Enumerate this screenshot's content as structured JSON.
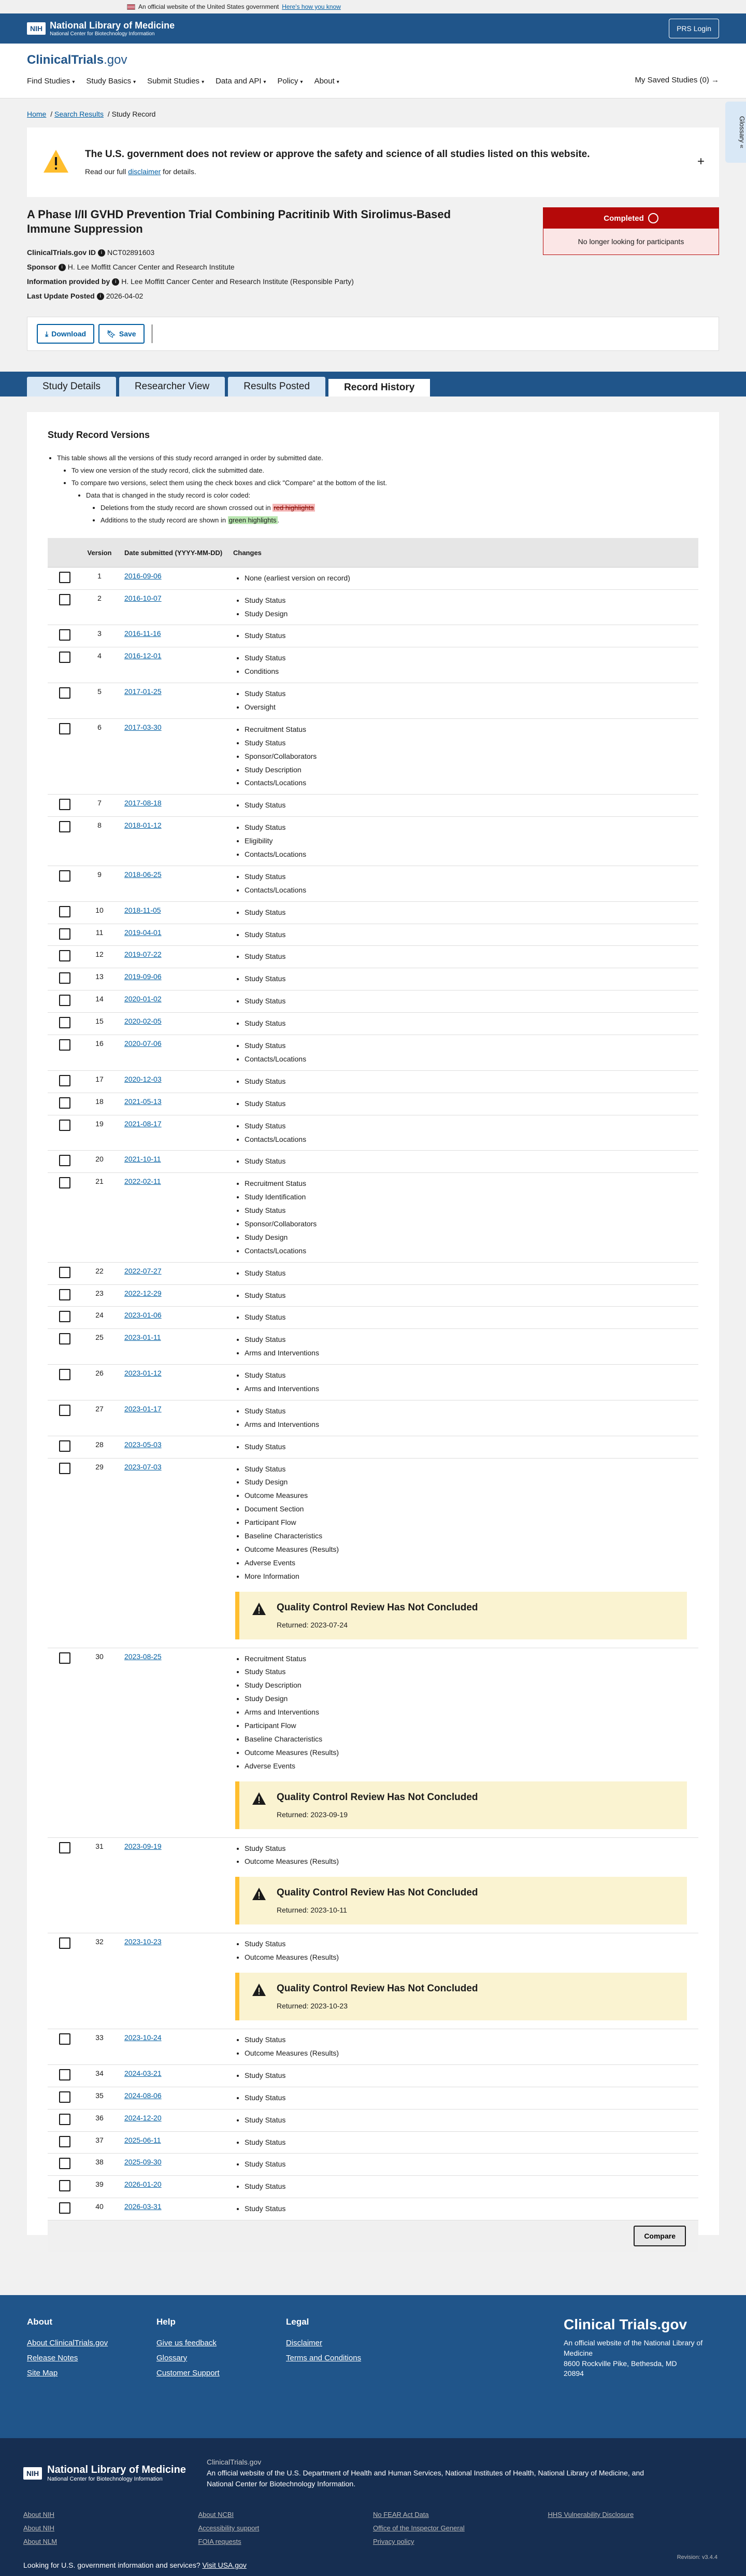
{
  "gov_banner": {
    "text": "An official website of the United States government",
    "link": "Here's how you know"
  },
  "nih": {
    "box": "NIH",
    "title": "National Library of Medicine",
    "subtitle": "National Center for Biotechnology Information",
    "prs": "PRS Login"
  },
  "site": {
    "brand_a": "ClinicalTrials",
    "brand_b": ".gov",
    "nav": [
      "Find Studies",
      "Study Basics",
      "Submit Studies",
      "Data and API",
      "Policy",
      "About"
    ],
    "saved": "My Saved Studies (0) →",
    "glossary": "Glossary"
  },
  "breadcrumb": [
    "Home",
    "Search Results",
    "Study Record"
  ],
  "warning": {
    "title": "The U.S. government does not review or approve the safety and science of all studies listed on this website.",
    "text_a": "Read our full ",
    "link": "disclaimer",
    "text_b": " for details."
  },
  "study": {
    "title": "A Phase I/II GVHD Prevention Trial Combining Pacritinib With Sirolimus-Based Immune Suppression",
    "id_label": "ClinicalTrials.gov ID",
    "id": "NCT02891603",
    "sponsor_label": "Sponsor",
    "sponsor": "H. Lee Moffitt Cancer Center and Research Institute",
    "info_label": "Information provided by",
    "info": "H. Lee Moffitt Cancer Center and Research Institute (Responsible Party)",
    "update_label": "Last Update Posted",
    "update": "2026-04-02",
    "status": "Completed",
    "status_note": "No longer looking for participants"
  },
  "actions": {
    "download": "Download",
    "save": "Save"
  },
  "tabs": [
    "Study Details",
    "Researcher View",
    "Results Posted",
    "Record History"
  ],
  "history": {
    "title": "Study Record Versions",
    "notes": [
      "This table shows all the versions of this study record arranged in order by submitted date.",
      "To view one version of the study record, click the submitted date.",
      "To compare two versions, select them using the check boxes and click \"Compare\" at the bottom of the list.",
      "Data that is changed in the study record is color coded:",
      "Deletions from the study record are shown crossed out in ",
      "red highlights",
      "Additions to the study record are shown in ",
      "green highlights",
      "."
    ],
    "headers": [
      "Version",
      "Date submitted (YYYY-MM-DD)",
      "Changes"
    ],
    "rows": [
      {
        "v": "1",
        "d": "2016-09-06",
        "c": [
          "None (earliest version on record)"
        ]
      },
      {
        "v": "2",
        "d": "2016-10-07",
        "c": [
          "Study Status",
          "Study Design"
        ]
      },
      {
        "v": "3",
        "d": "2016-11-16",
        "c": [
          "Study Status"
        ]
      },
      {
        "v": "4",
        "d": "2016-12-01",
        "c": [
          "Study Status",
          "Conditions"
        ]
      },
      {
        "v": "5",
        "d": "2017-01-25",
        "c": [
          "Study Status",
          "Oversight"
        ]
      },
      {
        "v": "6",
        "d": "2017-03-30",
        "c": [
          "Recruitment Status",
          "Study Status",
          "Sponsor/Collaborators",
          "Study Description",
          "Contacts/Locations"
        ]
      },
      {
        "v": "7",
        "d": "2017-08-18",
        "c": [
          "Study Status"
        ]
      },
      {
        "v": "8",
        "d": "2018-01-12",
        "c": [
          "Study Status",
          "Eligibility",
          "Contacts/Locations"
        ]
      },
      {
        "v": "9",
        "d": "2018-06-25",
        "c": [
          "Study Status",
          "Contacts/Locations"
        ]
      },
      {
        "v": "10",
        "d": "2018-11-05",
        "c": [
          "Study Status"
        ]
      },
      {
        "v": "11",
        "d": "2019-04-01",
        "c": [
          "Study Status"
        ]
      },
      {
        "v": "12",
        "d": "2019-07-22",
        "c": [
          "Study Status"
        ]
      },
      {
        "v": "13",
        "d": "2019-09-06",
        "c": [
          "Study Status"
        ]
      },
      {
        "v": "14",
        "d": "2020-01-02",
        "c": [
          "Study Status"
        ]
      },
      {
        "v": "15",
        "d": "2020-02-05",
        "c": [
          "Study Status"
        ]
      },
      {
        "v": "16",
        "d": "2020-07-06",
        "c": [
          "Study Status",
          "Contacts/Locations"
        ]
      },
      {
        "v": "17",
        "d": "2020-12-03",
        "c": [
          "Study Status"
        ]
      },
      {
        "v": "18",
        "d": "2021-05-13",
        "c": [
          "Study Status"
        ]
      },
      {
        "v": "19",
        "d": "2021-08-17",
        "c": [
          "Study Status",
          "Contacts/Locations"
        ]
      },
      {
        "v": "20",
        "d": "2021-10-11",
        "c": [
          "Study Status"
        ]
      },
      {
        "v": "21",
        "d": "2022-02-11",
        "c": [
          "Recruitment Status",
          "Study Identification",
          "Study Status",
          "Sponsor/Collaborators",
          "Study Design",
          "Contacts/Locations"
        ]
      },
      {
        "v": "22",
        "d": "2022-07-27",
        "c": [
          "Study Status"
        ]
      },
      {
        "v": "23",
        "d": "2022-12-29",
        "c": [
          "Study Status"
        ]
      },
      {
        "v": "24",
        "d": "2023-01-06",
        "c": [
          "Study Status"
        ]
      },
      {
        "v": "25",
        "d": "2023-01-11",
        "c": [
          "Study Status",
          "Arms and Interventions"
        ]
      },
      {
        "v": "26",
        "d": "2023-01-12",
        "c": [
          "Study Status",
          "Arms and Interventions"
        ]
      },
      {
        "v": "27",
        "d": "2023-01-17",
        "c": [
          "Study Status",
          "Arms and Interventions"
        ]
      },
      {
        "v": "28",
        "d": "2023-05-03",
        "c": [
          "Study Status"
        ]
      },
      {
        "v": "29",
        "d": "2023-07-03",
        "c": [
          "Study Status",
          "Study Design",
          "Outcome Measures",
          "Document Section",
          "Participant Flow",
          "Baseline Characteristics",
          "Outcome Measures (Results)",
          "Adverse Events",
          "More Information"
        ],
        "qc": "Returned: 2023-07-24"
      },
      {
        "v": "30",
        "d": "2023-08-25",
        "c": [
          "Recruitment Status",
          "Study Status",
          "Study Description",
          "Study Design",
          "Arms and Interventions",
          "Participant Flow",
          "Baseline Characteristics",
          "Outcome Measures (Results)",
          "Adverse Events"
        ],
        "qc": "Returned: 2023-09-19"
      },
      {
        "v": "31",
        "d": "2023-09-19",
        "c": [
          "Study Status",
          "Outcome Measures (Results)"
        ],
        "qc": "Returned: 2023-10-11"
      },
      {
        "v": "32",
        "d": "2023-10-23",
        "c": [
          "Study Status",
          "Outcome Measures (Results)"
        ],
        "qc": "Returned: 2023-10-23"
      },
      {
        "v": "33",
        "d": "2023-10-24",
        "c": [
          "Study Status",
          "Outcome Measures (Results)"
        ]
      },
      {
        "v": "34",
        "d": "2024-03-21",
        "c": [
          "Study Status"
        ]
      },
      {
        "v": "35",
        "d": "2024-08-06",
        "c": [
          "Study Status"
        ]
      },
      {
        "v": "36",
        "d": "2024-12-20",
        "c": [
          "Study Status"
        ]
      },
      {
        "v": "37",
        "d": "2025-06-11",
        "c": [
          "Study Status"
        ]
      },
      {
        "v": "38",
        "d": "2025-09-30",
        "c": [
          "Study Status"
        ]
      },
      {
        "v": "39",
        "d": "2026-01-20",
        "c": [
          "Study Status"
        ]
      },
      {
        "v": "40",
        "d": "2026-03-31",
        "c": [
          "Study Status"
        ]
      }
    ],
    "qc_title": "Quality Control Review Has Not Concluded",
    "compare": "Compare"
  },
  "footer": {
    "about_h": "About",
    "about": [
      "About ClinicalTrials.gov",
      "Release Notes",
      "Site Map"
    ],
    "help_h": "Help",
    "help": [
      "Give us feedback",
      "Glossary",
      "Customer Support"
    ],
    "legal_h": "Legal",
    "legal": [
      "Disclaimer",
      "Terms and Conditions"
    ],
    "brand": "Clinical Trials.gov",
    "addr": [
      "An official website of the National Library of Medicine",
      "8600 Rockville Pike, Bethesda, MD",
      "20894"
    ]
  },
  "footer2": {
    "nlm_title": "National Library of Medicine",
    "nlm_sub": "National Center for Biotechnology Information",
    "site": "ClinicalTrials.gov",
    "official": "An official website of the U.S. Department of Health and Human Services, National Institutes of Health, National Library of Medicine, and National Center for Biotechnology Information.",
    "links": [
      [
        "About NIH",
        "About NIH",
        "About NLM"
      ],
      [
        "About NCBI",
        "Accessibility support",
        "FOIA requests"
      ],
      [
        "No FEAR Act Data",
        "Office of the Inspector General",
        "Privacy policy"
      ],
      [
        "HHS Vulnerability Disclosure"
      ]
    ],
    "q": "Looking for U.S. government information and services?",
    "q_link": "Visit USA.gov",
    "rev": "Revision: v3.4.4"
  },
  "colors": {
    "primary": "#20558a",
    "link": "#005ea2",
    "completed": "#b50909",
    "qc_accent": "#ffbe2e"
  },
  "icons": [
    "flag-icon",
    "info-icon",
    "warning-icon",
    "plus-icon",
    "download-icon",
    "bookmark-icon",
    "chevron-down-icon"
  ]
}
